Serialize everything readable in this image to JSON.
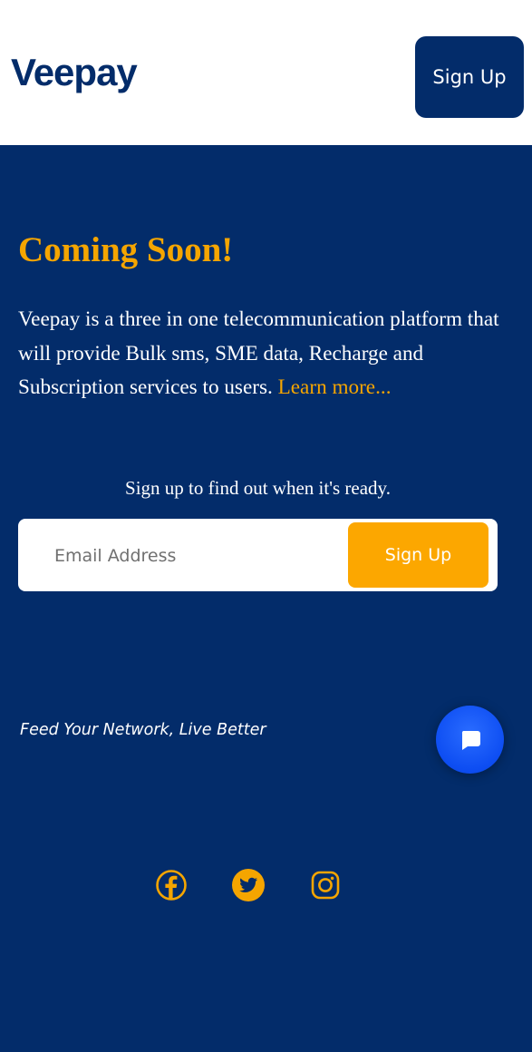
{
  "header": {
    "logo_text": "Veepay",
    "signup_label": "Sign Up"
  },
  "hero": {
    "title": "Coming Soon!",
    "description": "Veepay is a three in one telecommunication platform that will provide Bulk sms, SME data, Recharge and Subscription services to users. ",
    "learn_more": "Learn more..."
  },
  "signup": {
    "prompt": "Sign up to find out when it's ready.",
    "email_placeholder": "Email Address",
    "button_label": "Sign Up"
  },
  "tagline": "Feed Your Network, Live Better",
  "social": [
    {
      "icon": "facebook-icon"
    },
    {
      "icon": "twitter-icon"
    },
    {
      "icon": "instagram-icon"
    }
  ],
  "chat": {
    "icon": "chat-bubble-icon"
  },
  "colors": {
    "navy": "#032c6a",
    "accent": "#f5a500",
    "button_accent": "#fca700",
    "chat_blue": "#0d4df2",
    "white": "#ffffff"
  }
}
